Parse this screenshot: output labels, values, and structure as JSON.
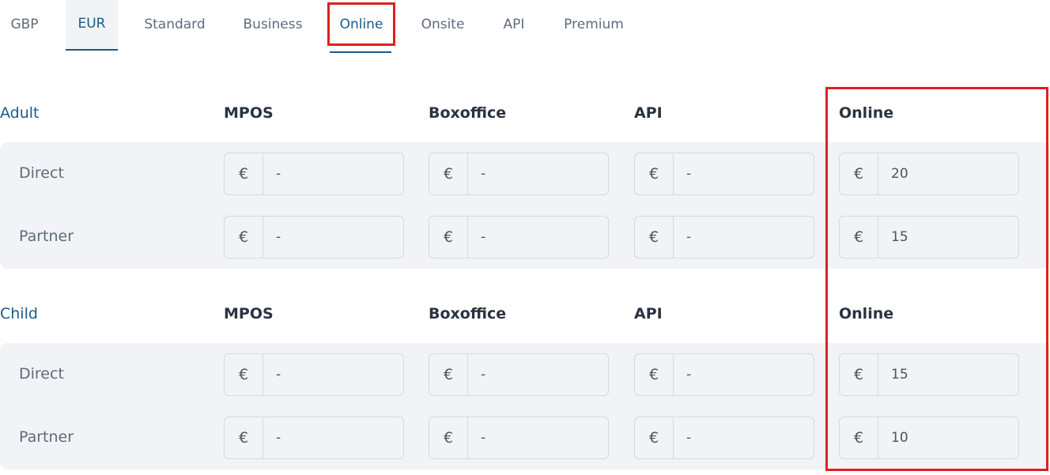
{
  "tabs": {
    "currencies": [
      "GBP",
      "EUR"
    ],
    "channels": [
      "Standard",
      "Business",
      "Online",
      "Onsite",
      "API",
      "Premium"
    ],
    "active_currency": "EUR",
    "active_channel": "Online"
  },
  "columns": [
    "MPOS",
    "Boxoffice",
    "API",
    "Online"
  ],
  "currency_symbol": "€",
  "groups": [
    {
      "title": "Adult",
      "rows": [
        {
          "label": "Direct",
          "values": [
            "-",
            "-",
            "-",
            "20"
          ]
        },
        {
          "label": "Partner",
          "values": [
            "-",
            "-",
            "-",
            "15"
          ]
        }
      ]
    },
    {
      "title": "Child",
      "rows": [
        {
          "label": "Direct",
          "values": [
            "-",
            "-",
            "-",
            "15"
          ]
        },
        {
          "label": "Partner",
          "values": [
            "-",
            "-",
            "-",
            "10"
          ]
        }
      ]
    }
  ],
  "colors": {
    "accent": "#1d5a86",
    "highlight": "#e02020",
    "panel_bg": "#f1f3f6"
  }
}
